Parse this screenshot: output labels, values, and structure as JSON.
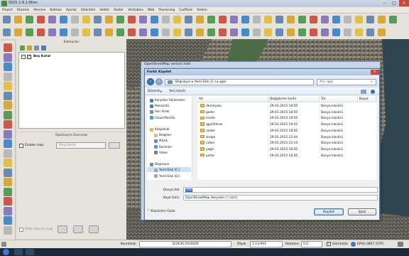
{
  "app": {
    "title": "QGIS 2.8.1-Wien"
  },
  "menu": [
    "Project",
    "Düzenle",
    "Pencere",
    "Katman",
    "Ayarlar",
    "Eklentiler",
    "Vektör",
    "Raster",
    "Veritabanı",
    "Web",
    "Processing",
    "CadTools",
    "Yardım"
  ],
  "layers_panel": {
    "title": "Katmanlar",
    "group": "Boş Katal"
  },
  "overview_panel": {
    "title": "Openlayers Overview",
    "enable_label": "Enable map",
    "dropdown": "Bing Kartal",
    "hide_label": "Hide cross in map"
  },
  "osm_window_title": "OpenStreetMap verisini indir",
  "dialog": {
    "title": "Farklı Kaydet",
    "path": [
      "Bilgisayar",
      "Yerel Disk (C:)",
      "qgis"
    ],
    "search_placeholder": "Ara: qgis",
    "organize": "Düzenle",
    "new_folder": "Yeni klasör",
    "nav": [
      {
        "label": "Karşıdan Yüklemeler",
        "color": "#4a7bc8"
      },
      {
        "label": "Masaüstü",
        "color": "#3d7fd8"
      },
      {
        "label": "Son Yerler",
        "color": "#8a8a8a"
      },
      {
        "label": "Cloud Mail.Ru",
        "color": "#3aa0e0"
      },
      {
        "label": "",
        "color": "#ffffff"
      },
      {
        "label": "Kitaplıklar",
        "color": "#e0b84a"
      },
      {
        "label": "Belgeler",
        "color": "#e0c070"
      },
      {
        "label": "Müzik",
        "color": "#5a8fd0"
      },
      {
        "label": "Resimler",
        "color": "#4ea0d8"
      },
      {
        "label": "Video",
        "color": "#6a78c8"
      },
      {
        "label": "",
        "color": "#ffffff"
      },
      {
        "label": "Bilgisayar",
        "color": "#6a8fb8"
      },
      {
        "label": "Yerel Disk (C:)",
        "color": "#9aa8b8"
      },
      {
        "label": "Yerel Disk (D:)",
        "color": "#9aa8b8"
      }
    ],
    "columns": [
      "Ad",
      "Değiştirme tarihi",
      "Tür",
      "Boyut"
    ],
    "files": [
      {
        "name": "demiryolu",
        "date": "29.03.2015 18:50",
        "type": "Dosya klasörü"
      },
      {
        "name": "goller",
        "date": "29.03.2015 18:50",
        "type": "Dosya klasörü"
      },
      {
        "name": "ilceler",
        "date": "29.03.2015 18:50",
        "type": "Dosya klasörü"
      },
      {
        "name": "qgis2three",
        "date": "29.03.2015 19:02",
        "type": "Dosya klasörü"
      },
      {
        "name": "raster",
        "date": "29.03.2015 18:50",
        "type": "Dosya klasörü"
      },
      {
        "name": "shape",
        "date": "29.03.2015 22:44",
        "type": "Dosya klasörü"
      },
      {
        "name": "video",
        "date": "29.03.2015 23:14",
        "type": "Dosya klasörü"
      },
      {
        "name": "yagis",
        "date": "29.03.2015 18:50",
        "type": "Dosya klasörü"
      },
      {
        "name": "yollar",
        "date": "29.03.2015 18:50",
        "type": "Dosya klasörü"
      }
    ],
    "filename_label": "Dosya Adı:",
    "filename_value": "ista",
    "filetype_label": "Kayıt türü:",
    "filetype_value": "OpenStreetMap dosyaları (*.osm)",
    "hide_folders": "Klasörleri Gizle",
    "save": "Kaydet",
    "cancel": "İptal"
  },
  "status": {
    "coord_label": "Koordinat:",
    "coord_value": "322636,5014626",
    "scale_label": "Ölçek",
    "scale_value": "1:13,993",
    "rotation_label": "Rotation:",
    "rotation_value": "0,0",
    "render_label": "Görüntüle",
    "crs": "EPSG:3857 (OTF)"
  }
}
